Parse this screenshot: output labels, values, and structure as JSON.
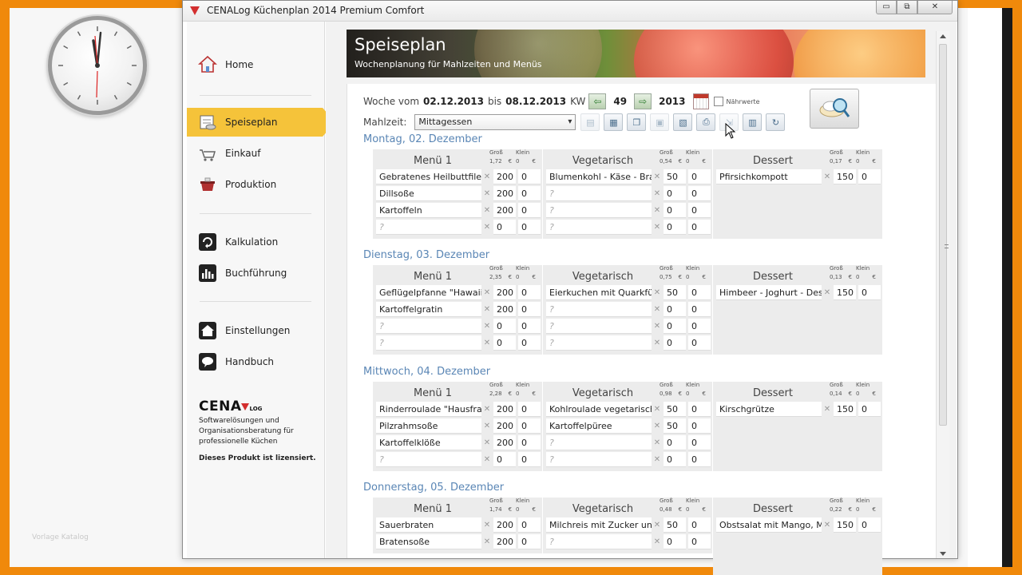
{
  "window": {
    "title": "CENALog Küchenplan 2014 Premium Comfort",
    "buttons": {
      "minimize": "▭",
      "maximize": "⧉",
      "close": "✕"
    }
  },
  "desktop": {
    "watermark": "Vorlage Katalog"
  },
  "sidebar": {
    "items": [
      {
        "label": "Home",
        "icon": "home-icon"
      },
      {
        "label": "Speiseplan",
        "icon": "menu-plan-icon",
        "active": true
      },
      {
        "label": "Einkauf",
        "icon": "shopping-icon"
      },
      {
        "label": "Produktion",
        "icon": "pot-icon"
      },
      {
        "label": "Kalkulation",
        "icon": "calculation-icon"
      },
      {
        "label": "Buchführung",
        "icon": "accounting-icon"
      },
      {
        "label": "Einstellungen",
        "icon": "settings-home-icon"
      },
      {
        "label": "Handbuch",
        "icon": "manual-icon"
      }
    ],
    "logo": {
      "main": "CENA",
      "sub": "LOG",
      "tagline": "Softwarelösungen und Organisationsberatung für professionelle Küchen",
      "license": "Dieses Produkt ist lizensiert."
    }
  },
  "banner": {
    "title": "Speiseplan",
    "subtitle": "Wochenplanung für Mahlzeiten und Menüs"
  },
  "week": {
    "prefix": "Woche vom",
    "from": "02.12.2013",
    "bis": "bis",
    "to": "08.12.2013",
    "kw_label": "KW",
    "kw": "49",
    "year": "2013",
    "naehrwerte": "Nährwerte"
  },
  "meal": {
    "label": "Mahlzeit:",
    "selected": "Mittagessen"
  },
  "labels": {
    "gross": "Groß",
    "klein": "Klein",
    "euro": "€"
  },
  "days": [
    {
      "title": "Montag, 02. Dezember",
      "blocks": [
        {
          "name": "Menü 1",
          "gross": "1,72",
          "klein": "0",
          "dishes": [
            {
              "name": "Gebratenes Heilbuttfilet",
              "g": "200",
              "k": "0"
            },
            {
              "name": "Dillsoße",
              "g": "200",
              "k": "0"
            },
            {
              "name": "Kartoffeln",
              "g": "200",
              "k": "0"
            },
            {
              "name": "?",
              "g": "0",
              "k": "0"
            }
          ]
        },
        {
          "name": "Vegetarisch",
          "gross": "0,54",
          "klein": "0",
          "dishes": [
            {
              "name": "Blumenkohl - Käse - Bratling",
              "g": "50",
              "k": "0"
            },
            {
              "name": "?",
              "g": "0",
              "k": "0"
            },
            {
              "name": "?",
              "g": "0",
              "k": "0"
            },
            {
              "name": "?",
              "g": "0",
              "k": "0"
            }
          ]
        },
        {
          "name": "Dessert",
          "gross": "0,17",
          "klein": "0",
          "dishes": [
            {
              "name": "Pfirsichkompott",
              "g": "150",
              "k": "0"
            }
          ]
        }
      ]
    },
    {
      "title": "Dienstag, 03. Dezember",
      "blocks": [
        {
          "name": "Menü 1",
          "gross": "2,35",
          "klein": "0",
          "dishes": [
            {
              "name": "Geflügelpfanne \"Hawaii\"",
              "g": "200",
              "k": "0"
            },
            {
              "name": "Kartoffelgratin",
              "g": "200",
              "k": "0"
            },
            {
              "name": "?",
              "g": "0",
              "k": "0"
            },
            {
              "name": "?",
              "g": "0",
              "k": "0"
            }
          ]
        },
        {
          "name": "Vegetarisch",
          "gross": "0,75",
          "klein": "0",
          "dishes": [
            {
              "name": "Eierkuchen mit Quarkfüllung",
              "g": "50",
              "k": "0"
            },
            {
              "name": "?",
              "g": "0",
              "k": "0"
            },
            {
              "name": "?",
              "g": "0",
              "k": "0"
            },
            {
              "name": "?",
              "g": "0",
              "k": "0"
            }
          ]
        },
        {
          "name": "Dessert",
          "gross": "0,13",
          "klein": "0",
          "dishes": [
            {
              "name": "Himbeer - Joghurt - Dessert",
              "g": "150",
              "k": "0"
            }
          ]
        }
      ]
    },
    {
      "title": "Mittwoch, 04. Dezember",
      "blocks": [
        {
          "name": "Menü 1",
          "gross": "2,28",
          "klein": "0",
          "dishes": [
            {
              "name": "Rinderroulade \"Hausfrauenart\"",
              "g": "200",
              "k": "0"
            },
            {
              "name": "Pilzrahmsoße",
              "g": "200",
              "k": "0"
            },
            {
              "name": "Kartoffelklöße",
              "g": "200",
              "k": "0"
            },
            {
              "name": "?",
              "g": "0",
              "k": "0"
            }
          ]
        },
        {
          "name": "Vegetarisch",
          "gross": "0,98",
          "klein": "0",
          "dishes": [
            {
              "name": "Kohlroulade vegetarisch",
              "g": "50",
              "k": "0"
            },
            {
              "name": "Kartoffelpüree",
              "g": "50",
              "k": "0"
            },
            {
              "name": "?",
              "g": "0",
              "k": "0"
            },
            {
              "name": "?",
              "g": "0",
              "k": "0"
            }
          ]
        },
        {
          "name": "Dessert",
          "gross": "0,14",
          "klein": "0",
          "dishes": [
            {
              "name": "Kirschgrütze",
              "g": "150",
              "k": "0"
            }
          ]
        }
      ]
    },
    {
      "title": "Donnerstag, 05. Dezember",
      "blocks": [
        {
          "name": "Menü 1",
          "gross": "1,74",
          "klein": "0",
          "dishes": [
            {
              "name": "Sauerbraten",
              "g": "200",
              "k": "0"
            },
            {
              "name": "Bratensoße",
              "g": "200",
              "k": "0"
            }
          ]
        },
        {
          "name": "Vegetarisch",
          "gross": "0,48",
          "klein": "0",
          "dishes": [
            {
              "name": "Milchreis mit Zucker und Zimt",
              "g": "50",
              "k": "0"
            },
            {
              "name": "?",
              "g": "0",
              "k": "0"
            }
          ]
        },
        {
          "name": "Dessert",
          "gross": "0,22",
          "klein": "0",
          "dishes": [
            {
              "name": "Obstsalat mit Mango, Melone",
              "g": "150",
              "k": "0"
            }
          ]
        }
      ]
    }
  ]
}
